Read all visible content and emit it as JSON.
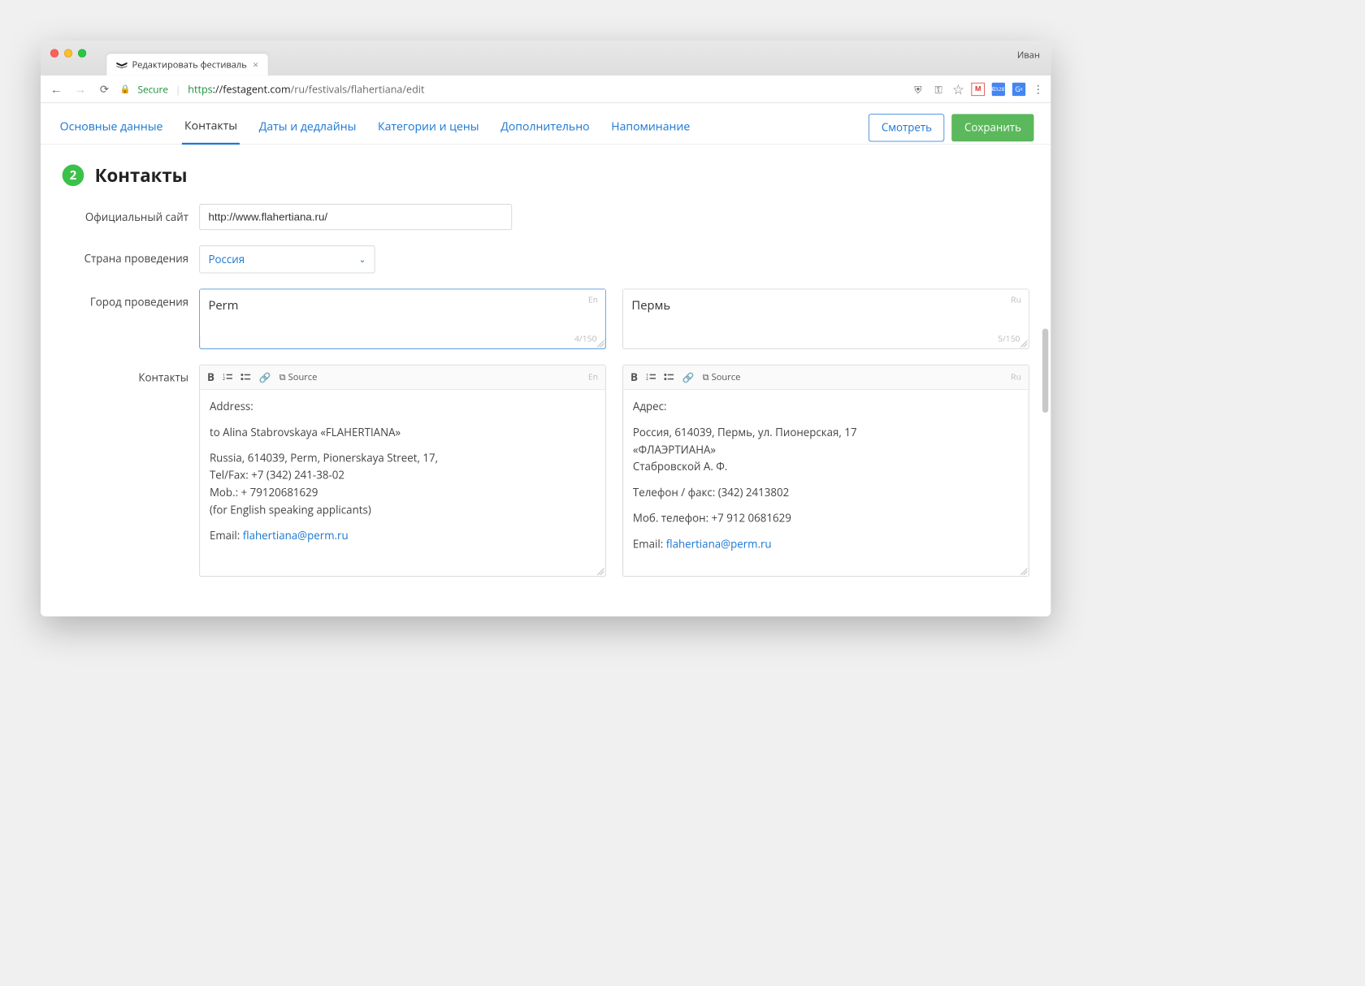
{
  "chrome": {
    "tab_title": "Редактировать фестиваль",
    "user_name": "Иван",
    "secure_label": "Secure",
    "url_proto": "https",
    "url_host": "://festagent.com",
    "url_path": "/ru/festivals/flahertiana/edit",
    "mail_badge": "3287"
  },
  "tabs": {
    "t0": "Основные данные",
    "t1": "Контакты",
    "t2": "Даты и дедлайны",
    "t3": "Категории и цены",
    "t4": "Дополнительно",
    "t5": "Напоминание"
  },
  "actions": {
    "view": "Смотреть",
    "save": "Сохранить"
  },
  "section": {
    "step": "2",
    "title": "Контакты"
  },
  "labels": {
    "site": "Официальный сайт",
    "country": "Страна проведения",
    "city": "Город проведения",
    "contacts": "Контакты"
  },
  "site": {
    "value": "http://www.flahertiana.ru/"
  },
  "country": {
    "value": "Россия"
  },
  "city": {
    "en": {
      "value": "Perm",
      "lang": "En",
      "counter": "4/150"
    },
    "ru": {
      "value": "Пермь",
      "lang": "Ru",
      "counter": "5/150"
    }
  },
  "rte": {
    "source_label": "Source"
  },
  "contacts_en": {
    "lang": "En",
    "l1": "Address:",
    "l2": "to Alina Stabrovskaya «FLAHERTIANA»",
    "l3": "Russia, 614039, Perm, Pionerskaya Street, 17,",
    "l4": "Tel/Fax: +7 (342) 241-38-02",
    "l5": "Mob.: + 79120681629",
    "l6": "(for English speaking applicants)",
    "l7a": "Email: ",
    "l7b": "flahertiana@perm.ru"
  },
  "contacts_ru": {
    "lang": "Ru",
    "l1": "Адрес:",
    "l2": "Россия, 614039, Пермь, ул. Пионерская, 17",
    "l3": "«ФЛАЭРТИАНА»",
    "l4": "Стабровской А. Ф.",
    "l5": "Телефон / факс: (342) 2413802",
    "l6": "Моб. телефон: +7 912 0681629",
    "l7a": "Email: ",
    "l7b": "flahertiana@perm.ru"
  }
}
